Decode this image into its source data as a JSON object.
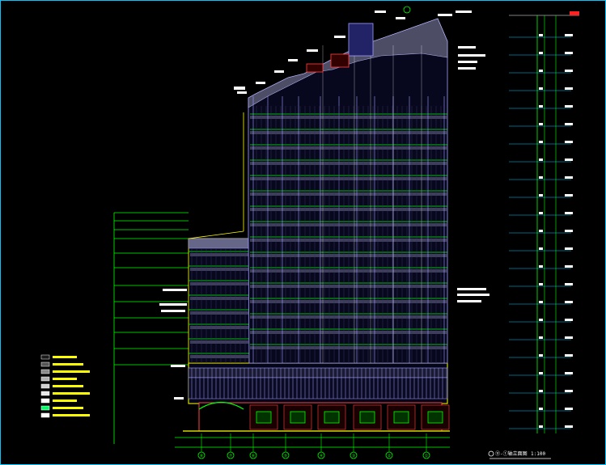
{
  "drawing": {
    "title_label": "⑪-①轴立面图",
    "scale_label": "1:100"
  },
  "grid_axes": [
    "⑪",
    "⑩",
    "⑨",
    "⑧",
    "⑦",
    "⑥",
    "⑤",
    "④",
    "③",
    "②",
    "①"
  ],
  "legend_items": [
    {
      "swatch": "#1a1a1a",
      "label": ""
    },
    {
      "swatch": "#555555",
      "label": ""
    },
    {
      "swatch": "#888888",
      "label": ""
    },
    {
      "swatch": "#b0b0b0",
      "label": ""
    },
    {
      "swatch": "#d0d0d0",
      "label": ""
    },
    {
      "swatch": "#e8e8e8",
      "label": ""
    },
    {
      "swatch": "#ffffff",
      "label": ""
    },
    {
      "swatch": "#00ff66",
      "label": ""
    },
    {
      "swatch": "#ffffff",
      "label": ""
    }
  ],
  "colors": {
    "background": "#000000",
    "border": "#00c8ff",
    "facade": "#a0a0ff",
    "level_lines": "#00ff00",
    "text": "#ffffff",
    "highlight": "#ffff00",
    "annotation": "#ff0000"
  },
  "level_labels": [
    "",
    "",
    "",
    "",
    "",
    "",
    "",
    "",
    "",
    "",
    "",
    "",
    "",
    "",
    "",
    "",
    "",
    "",
    "",
    "",
    "",
    ""
  ]
}
